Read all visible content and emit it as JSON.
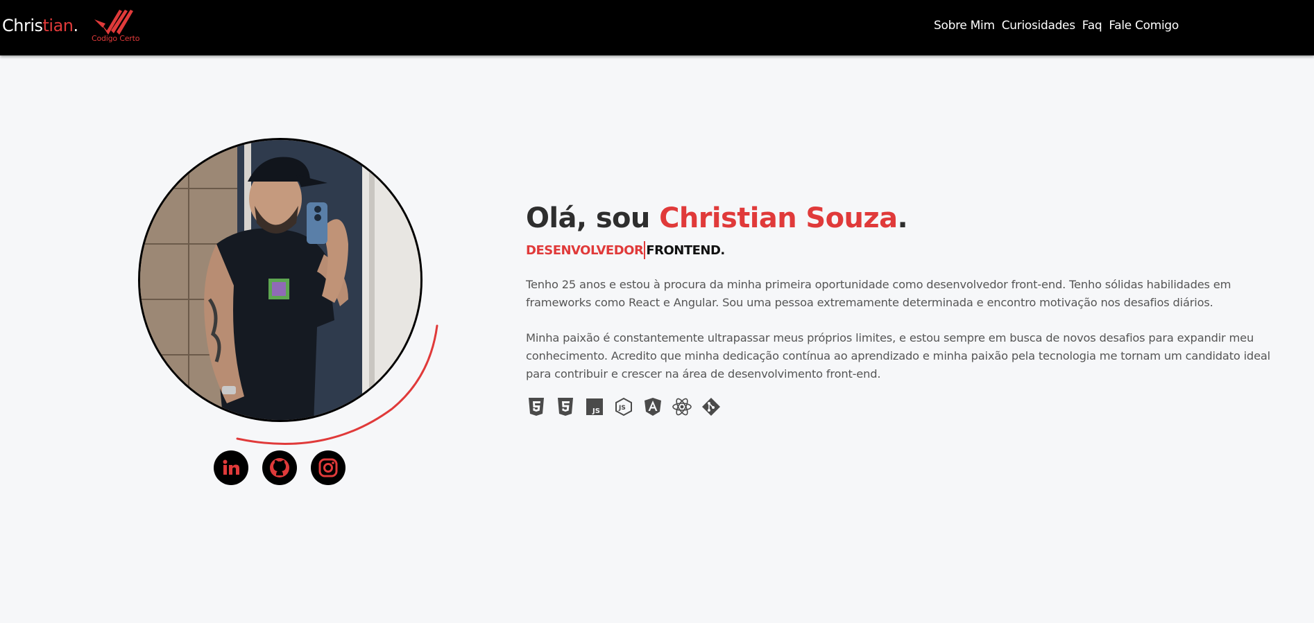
{
  "header": {
    "brand_first": "Chris",
    "brand_second": "tian",
    "brand_dot": ".",
    "logo_text": "Codigo Certo",
    "nav": [
      "Sobre Mim",
      "Curiosidades",
      "Faq",
      "Fale Comigo"
    ]
  },
  "hero": {
    "greeting": "Olá, sou ",
    "name": "Christian Souza",
    "greeting_dot": ".",
    "role_part1": "DESENVOLVEDOR",
    "role_part2": "FRONTEND.",
    "paragraph1": "Tenho 25 anos e estou à procura da minha primeira oportunidade como desenvolvedor front-end. Tenho sólidas habilidades em frameworks como React e Angular. Sou uma pessoa extremamente determinada e encontro motivação nos desafios diários.",
    "paragraph2": "Minha paixão é constantemente ultrapassar meus próprios limites, e estou sempre em busca de novos desafios para expandir meu conhecimento. Acredito que minha dedicação contínua ao aprendizado e minha paixão pela tecnologia me tornam um candidato ideal para contribuir e crescer na área de desenvolvimento front-end."
  },
  "socials": [
    {
      "icon": "linkedin-icon"
    },
    {
      "icon": "github-icon"
    },
    {
      "icon": "instagram-icon"
    }
  ],
  "tech_icons": [
    "html5-icon",
    "css3-icon",
    "javascript-icon",
    "nodejs-icon",
    "angular-icon",
    "react-icon",
    "git-icon"
  ],
  "colors": {
    "accent": "#e03a3a",
    "header_bg": "#000000",
    "page_bg": "#f6f7f9",
    "text": "#555555",
    "tech_icon": "#4a4a4a"
  }
}
